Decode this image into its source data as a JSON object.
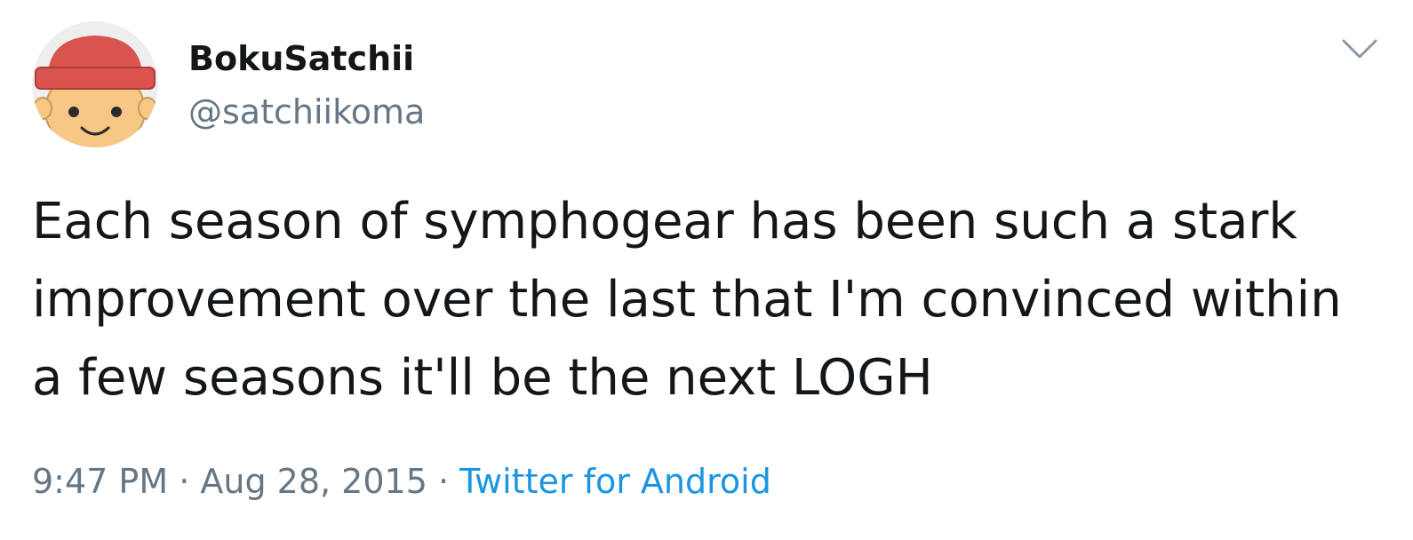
{
  "tweet": {
    "author": {
      "display_name": "BokuSatchii",
      "handle": "@satchiikoma"
    },
    "text": "Each season of symphogear has been such a stark improvement over the last that I'm convinced within a few seasons it'll be the next LOGH",
    "time": "9:47 PM",
    "separator": " · ",
    "date": "Aug 28, 2015",
    "source": "Twitter for Android",
    "icons": {
      "menu": "chevron-down-icon",
      "avatar": "cartoon-face-with-red-beanie"
    }
  },
  "colors": {
    "text_primary": "#14171a",
    "text_secondary": "#657786",
    "link": "#1b95e0",
    "background": "#ffffff",
    "avatar_hat": "#d9534f",
    "avatar_skin": "#f7c785"
  }
}
